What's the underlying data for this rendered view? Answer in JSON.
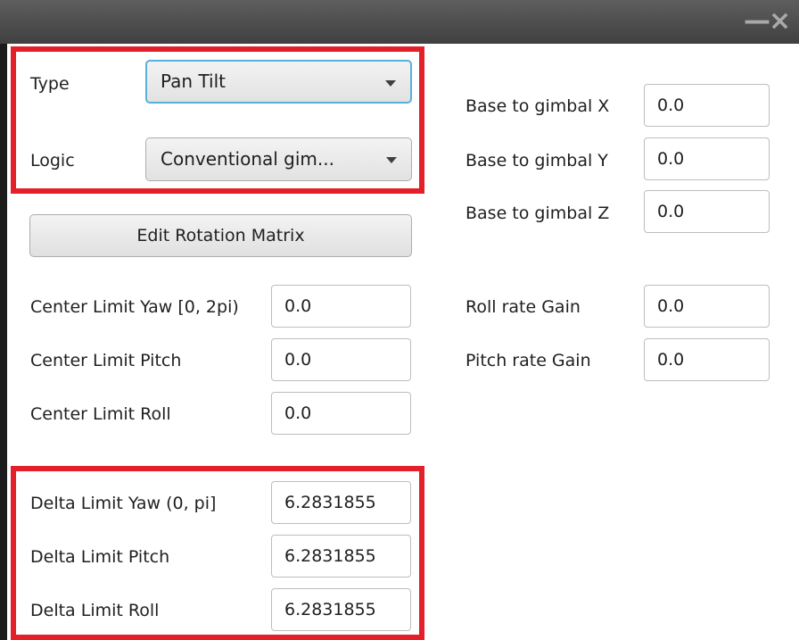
{
  "window": {
    "minimize_glyph": "—",
    "close_glyph": "×"
  },
  "type": {
    "label": "Type",
    "value": "Pan Tilt"
  },
  "logic": {
    "label": "Logic",
    "value": "Conventional gim..."
  },
  "edit_rotation_matrix": {
    "label": "Edit Rotation Matrix"
  },
  "center_limits": [
    {
      "label": "Center Limit Yaw [0, 2pi)",
      "value": "0.0"
    },
    {
      "label": "Center Limit Pitch",
      "value": "0.0"
    },
    {
      "label": "Center Limit Roll",
      "value": "0.0"
    }
  ],
  "delta_limits": [
    {
      "label": "Delta Limit Yaw (0, pi]",
      "value": "6.2831855"
    },
    {
      "label": "Delta Limit Pitch",
      "value": "6.2831855"
    },
    {
      "label": "Delta Limit Roll",
      "value": "6.2831855"
    }
  ],
  "base_to_gimbal": [
    {
      "label": "Base to gimbal X",
      "value": "0.0"
    },
    {
      "label": "Base to gimbal Y",
      "value": "0.0"
    },
    {
      "label": "Base to gimbal Z",
      "value": "0.0"
    }
  ],
  "rate_gains": [
    {
      "label": "Roll rate Gain",
      "value": "0.0"
    },
    {
      "label": "Pitch rate Gain",
      "value": "0.0"
    }
  ],
  "colors": {
    "highlight": "#e3202a",
    "focus": "#5ab0dc",
    "titlebar": "#4a4a4a"
  }
}
